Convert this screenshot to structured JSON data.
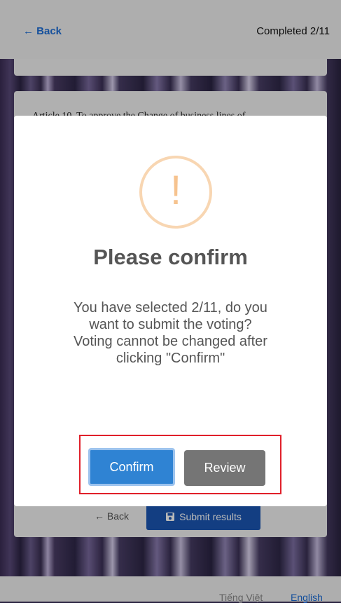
{
  "header": {
    "back_label": "← Back",
    "completed_label": "Completed 2/11"
  },
  "card": {
    "article_text": "Article 10. To approve the Change of business lines of",
    "back_label": "← Back",
    "submit_label": "Submit results"
  },
  "footer": {
    "lang_vi": "Tiếng Việt",
    "lang_en": "English"
  },
  "modal": {
    "icon": "!",
    "title": "Please confirm",
    "message": "You have selected 2/11, do you want to submit the voting? Voting cannot be changed after clicking \"Confirm\"",
    "confirm_label": "Confirm",
    "review_label": "Review"
  },
  "colors": {
    "link": "#1e6fd9",
    "confirm": "#2f83d3",
    "review": "#757575",
    "submit": "#1b57b5",
    "warning": "#f6c38f",
    "highlight": "#e0202a"
  }
}
